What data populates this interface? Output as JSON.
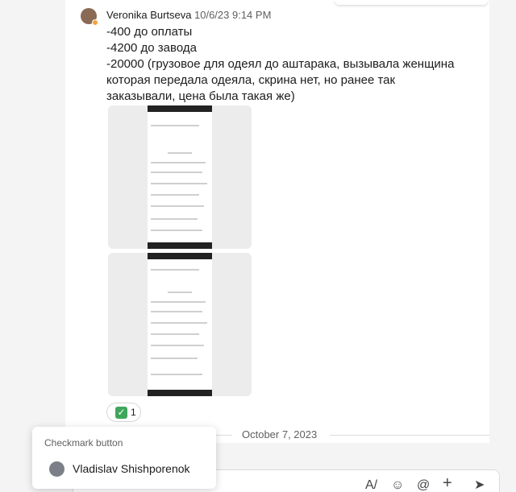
{
  "message": {
    "author": "Veronika Burtseva",
    "timestamp": "10/6/23 9:14 PM",
    "lines": [
      "-400 до оплаты",
      "-4200 до завода",
      "-20000 (грузовое для одеял до аштарака, вызывала женщина которая передала одеяла, скрина нет, но ранее так заказывали, цена была такая же)"
    ],
    "reaction": {
      "emoji": "✓",
      "count": "1"
    }
  },
  "date_divider": "October 7, 2023",
  "tooltip": {
    "title": "Checkmark button",
    "users": [
      "Vladislav Shishporenok"
    ]
  },
  "composer": {
    "hint": "/",
    "icons": [
      "format-icon",
      "emoji-icon",
      "mention-icon",
      "plus-icon",
      "send-icon"
    ]
  },
  "colors": {
    "reaction_check": "#3fa55b",
    "status_dot": "#f2a33a"
  }
}
